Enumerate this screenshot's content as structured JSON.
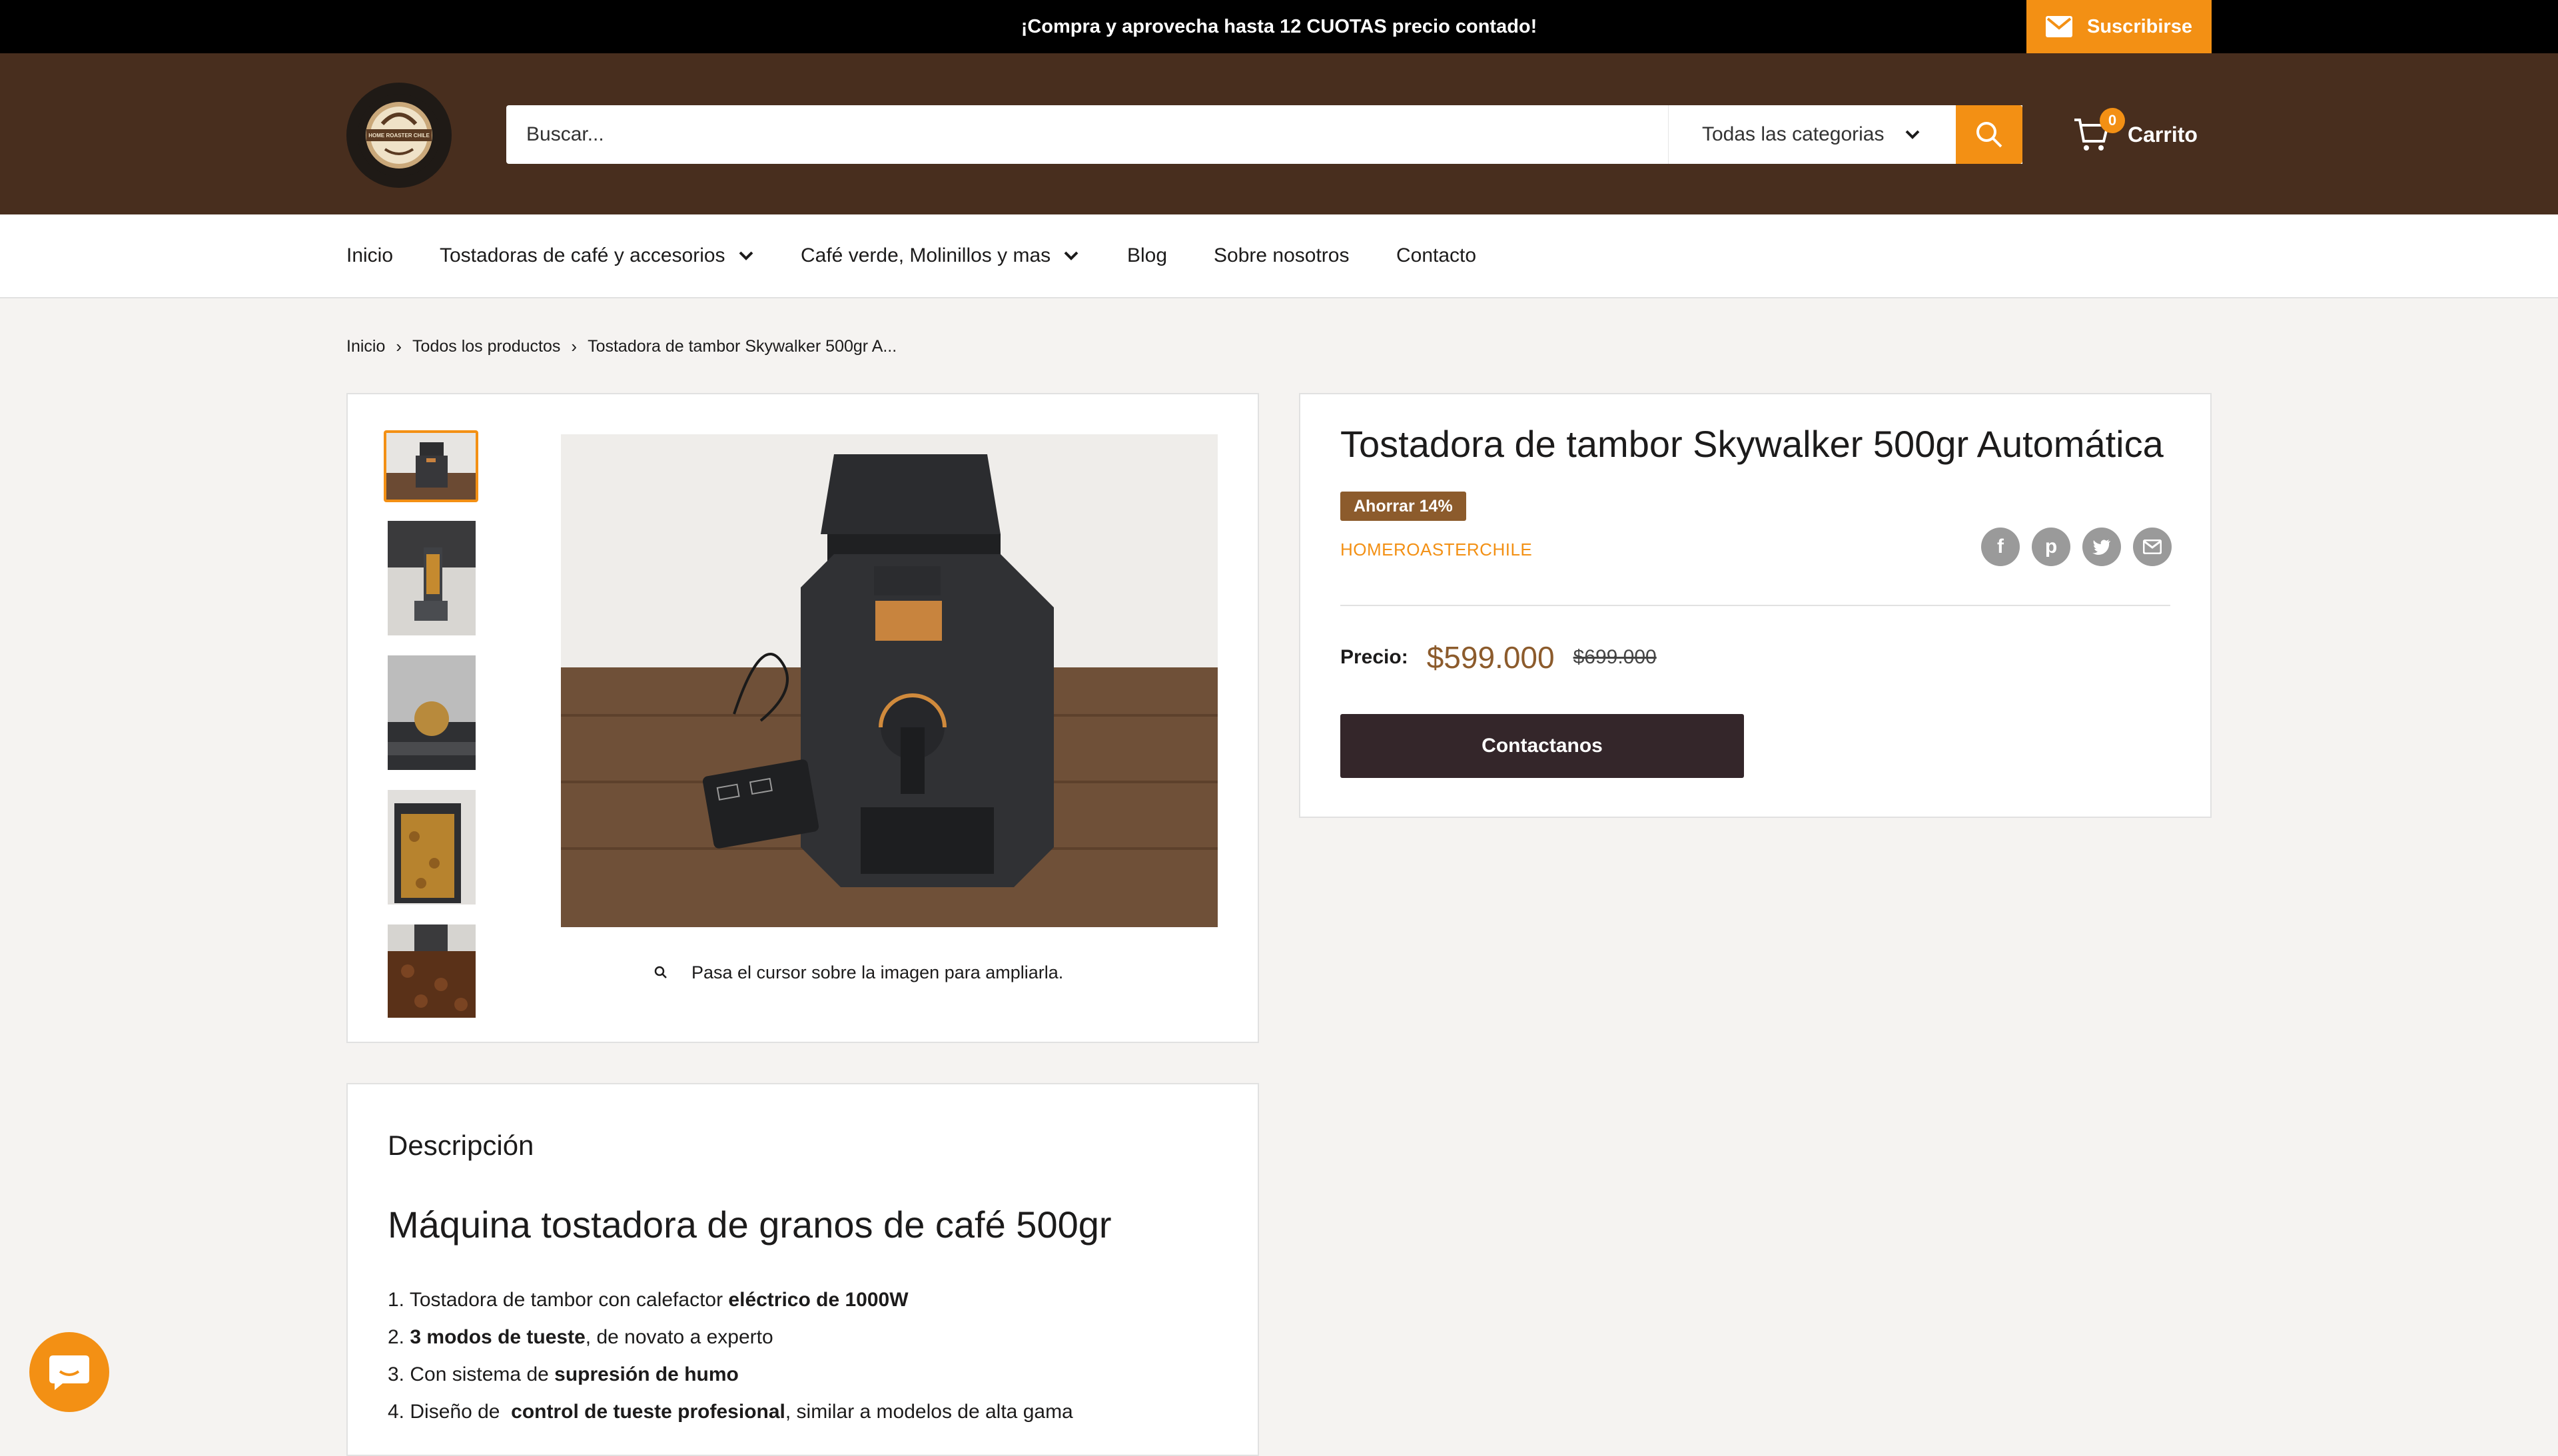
{
  "announcement": {
    "text": "¡Compra y aprovecha hasta 12 CUOTAS precio contado!",
    "subscribe_label": "Suscribirse"
  },
  "header": {
    "logo_text": "HOME ROASTER CHILE",
    "search_placeholder": "Buscar...",
    "category_label": "Todas las categorias",
    "cart_count": "0",
    "cart_label": "Carrito"
  },
  "nav": {
    "items": [
      {
        "label": "Inicio"
      },
      {
        "label": "Tostadoras de café y accesorios"
      },
      {
        "label": "Café verde, Molinillos y mas"
      },
      {
        "label": "Blog"
      },
      {
        "label": "Sobre nosotros"
      },
      {
        "label": "Contacto"
      }
    ]
  },
  "breadcrumb": [
    "Inicio",
    "Todos los productos",
    "Tostadora de tambor Skywalker 500gr A..."
  ],
  "gallery": {
    "zoom_hint": "Pasa el cursor sobre la imagen para ampliarla."
  },
  "product": {
    "title": "Tostadora de tambor Skywalker 500gr Automática",
    "save_badge": "Ahorrar 14%",
    "vendor": "HOMEROASTERCHILE",
    "price_label": "Precio:",
    "price_current": "$599.000",
    "price_old": "$699.000",
    "contact_label": "Contactanos",
    "share": [
      "facebook-icon",
      "pinterest-icon",
      "twitter-icon",
      "email-icon"
    ]
  },
  "description": {
    "title": "Descripción",
    "heading": "Máquina tostadora de granos de café 500gr",
    "items": [
      {
        "num": "1.",
        "pre": "Tostadora de tambor con calefactor ",
        "bold": "eléctrico de 1000W",
        "post": ""
      },
      {
        "num": "2.",
        "pre": "",
        "bold": "3 modos de tueste",
        "post": ", de novato a experto"
      },
      {
        "num": "3.",
        "pre": "Con sistema de ",
        "bold": "supresión de humo",
        "post": ""
      },
      {
        "num": "4.",
        "pre": "Diseño de  ",
        "bold": "control de tueste profesional",
        "post": ", similar a modelos de alta gama"
      }
    ]
  },
  "colors": {
    "accent": "#f39014",
    "header_bg": "#482e1e",
    "button_dark": "#34262a",
    "badge": "#8c5b2c"
  }
}
